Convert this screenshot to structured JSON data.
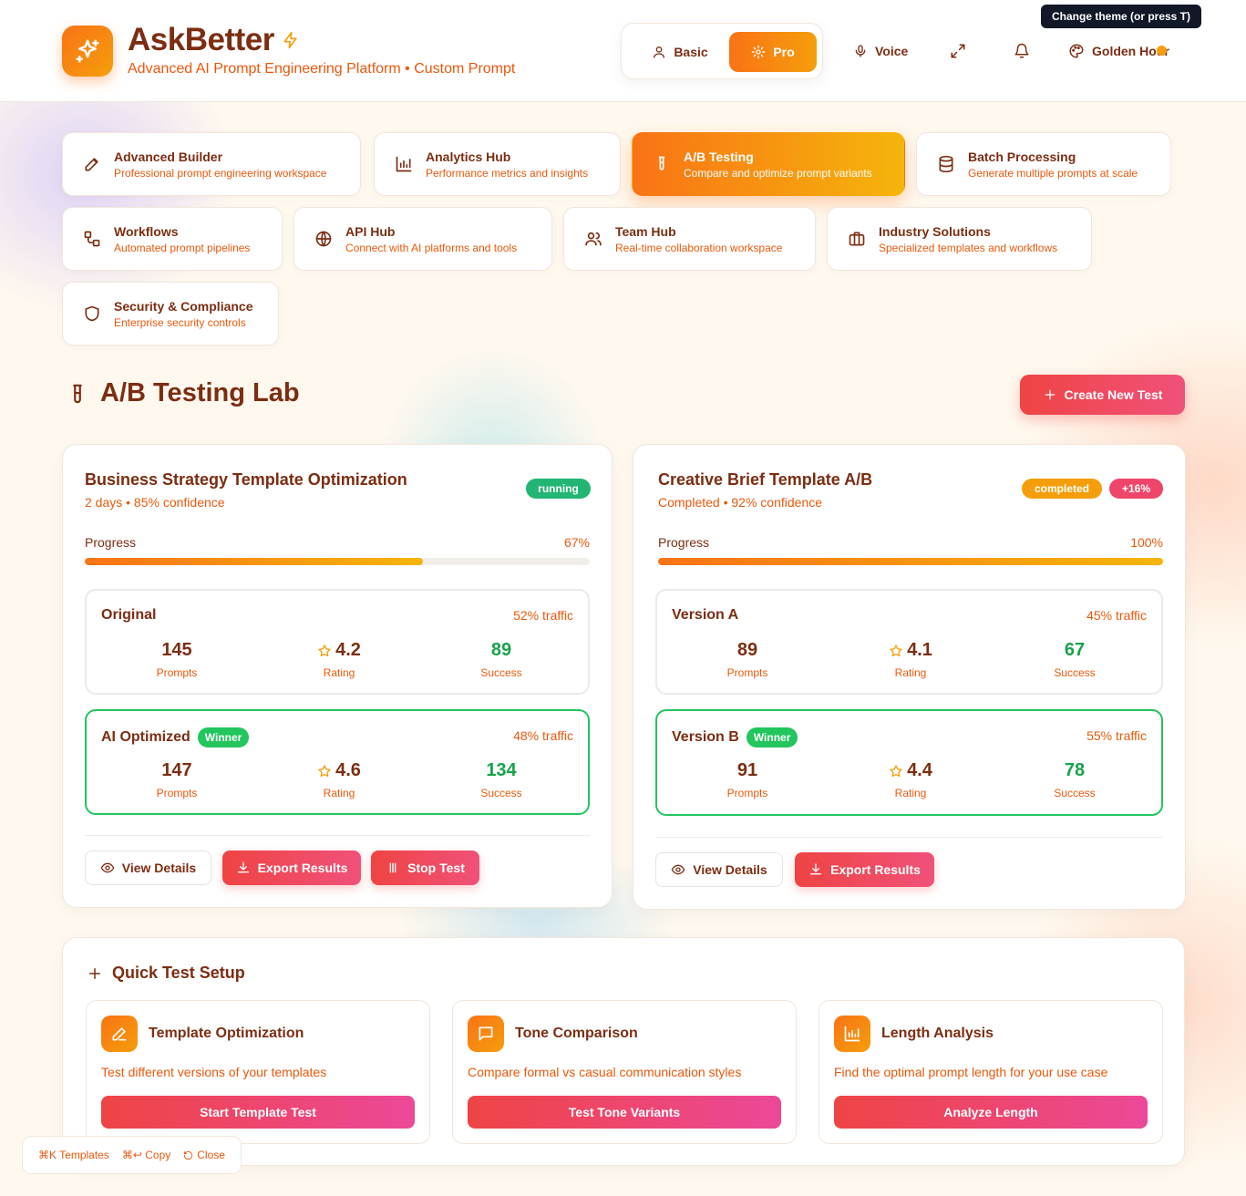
{
  "header": {
    "brand": "AskBetter",
    "subtitle": "Advanced AI Prompt Engineering Platform • Custom Prompt",
    "mode_basic": "Basic",
    "mode_pro": "Pro",
    "voice": "Voice",
    "theme": "Golden Hour",
    "theme_tooltip": "Change theme (or press T)"
  },
  "nav": [
    {
      "title": "Advanced Builder",
      "desc": "Professional prompt engineering workspace",
      "icon": "pencil-icon"
    },
    {
      "title": "Analytics Hub",
      "desc": "Performance metrics and insights",
      "icon": "bar-chart-icon"
    },
    {
      "title": "A/B Testing",
      "desc": "Compare and optimize prompt variants",
      "icon": "test-tube-icon",
      "active": true
    },
    {
      "title": "Batch Processing",
      "desc": "Generate multiple prompts at scale",
      "icon": "database-icon"
    },
    {
      "title": "Workflows",
      "desc": "Automated prompt pipelines",
      "icon": "workflow-icon"
    },
    {
      "title": "API Hub",
      "desc": "Connect with AI platforms and tools",
      "icon": "globe-icon"
    },
    {
      "title": "Team Hub",
      "desc": "Real-time collaboration workspace",
      "icon": "users-icon"
    },
    {
      "title": "Industry Solutions",
      "desc": "Specialized templates and workflows",
      "icon": "briefcase-icon"
    },
    {
      "title": "Security & Compliance",
      "desc": "Enterprise security controls",
      "icon": "shield-icon"
    }
  ],
  "lab": {
    "title": "A/B Testing Lab",
    "create_button": "Create New Test"
  },
  "tests": [
    {
      "title": "Business Strategy Template Optimization",
      "meta": "2 days • 85% confidence",
      "status": "running",
      "status_color": "#22b573",
      "progress_label": "Progress",
      "progress_text": "67%",
      "progress": 0.67,
      "variants": [
        {
          "name": "Original",
          "traffic": "52% traffic",
          "winner": false,
          "prompts": "145",
          "rating": "4.2",
          "success": "89"
        },
        {
          "name": "AI Optimized",
          "traffic": "48% traffic",
          "winner": true,
          "winner_label": "Winner",
          "prompts": "147",
          "rating": "4.6",
          "success": "134"
        }
      ],
      "stat_labels": {
        "prompts": "Prompts",
        "rating": "Rating",
        "success": "Success"
      },
      "view_details": "View Details",
      "export_results": "Export Results",
      "stop_test": "Stop Test"
    },
    {
      "title": "Creative Brief Template A/B",
      "meta": "Completed • 92% confidence",
      "status": "completed",
      "status_color": "#f59e0b",
      "lift": "+16%",
      "lift_color": "#f0456a",
      "progress_label": "Progress",
      "progress_text": "100%",
      "progress": 1.0,
      "variants": [
        {
          "name": "Version A",
          "traffic": "45% traffic",
          "winner": false,
          "prompts": "89",
          "rating": "4.1",
          "success": "67"
        },
        {
          "name": "Version B",
          "traffic": "55% traffic",
          "winner": true,
          "winner_label": "Winner",
          "prompts": "91",
          "rating": "4.4",
          "success": "78"
        }
      ],
      "stat_labels": {
        "prompts": "Prompts",
        "rating": "Rating",
        "success": "Success"
      },
      "view_details": "View Details",
      "export_results": "Export Results"
    }
  ],
  "quick": {
    "title": "Quick Test Setup",
    "cards": [
      {
        "name": "Template Optimization",
        "desc": "Test different versions of your templates",
        "button": "Start Template Test",
        "icon": "pencil-icon"
      },
      {
        "name": "Tone Comparison",
        "desc": "Compare formal vs casual communication styles",
        "button": "Test Tone Variants",
        "icon": "message-icon"
      },
      {
        "name": "Length Analysis",
        "desc": "Find the optimal prompt length for your use case",
        "button": "Analyze Length",
        "icon": "bar-chart-icon"
      }
    ]
  },
  "shortcuts": {
    "templates": "⌘K Templates",
    "copy": "⌘↩ Copy",
    "close": "Close"
  }
}
